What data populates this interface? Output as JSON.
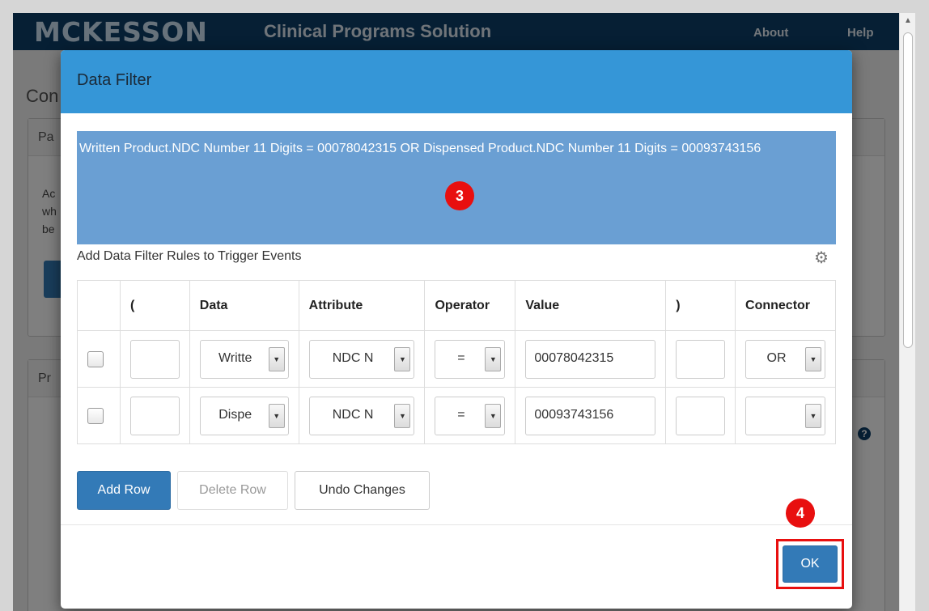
{
  "app": {
    "logo": "MCKESSON",
    "title": "Clinical Programs Solution",
    "nav": [
      "About",
      "Help"
    ]
  },
  "background": {
    "page_heading_fragment": "Con",
    "panel1_header_fragment": "Pa",
    "panel1_text_fragments": [
      "Ac",
      "wh",
      "be"
    ],
    "panel2_header_fragment": "Pr",
    "help_glyph": "?"
  },
  "dialog": {
    "title": "Data Filter",
    "summary_text": "Written Product.NDC Number 11 Digits = 00078042315 OR Dispensed Product.NDC Number 11 Digits = 00093743156",
    "rules_label": "Add Data Filter Rules to Trigger Events",
    "columns": [
      "",
      "(",
      "Data",
      "Attribute",
      "Operator",
      "Value",
      ")",
      "Connector"
    ],
    "rows": [
      {
        "open_paren": "",
        "data": "Writte",
        "attribute": "NDC N",
        "operator": "=",
        "value": "00078042315",
        "close_paren": "",
        "connector": "OR"
      },
      {
        "open_paren": "",
        "data": "Dispe",
        "attribute": "NDC N",
        "operator": "=",
        "value": "00093743156",
        "close_paren": "",
        "connector": ""
      }
    ],
    "buttons": {
      "add_row": "Add Row",
      "delete_row": "Delete Row",
      "undo_changes": "Undo Changes",
      "ok": "OK"
    }
  },
  "markers": [
    "3",
    "4"
  ],
  "colors": {
    "header_blue": "#3596d7",
    "summary_blue": "#6a9fd3",
    "primary_button": "#337ab7",
    "marker_red": "#e80f0f",
    "topbar_navy": "#0c3f68"
  }
}
